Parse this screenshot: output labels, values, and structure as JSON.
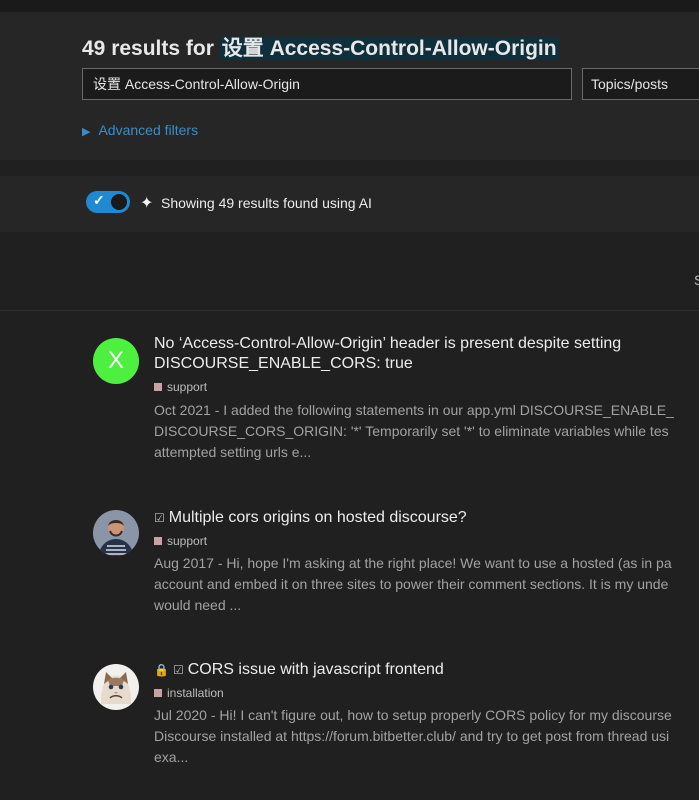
{
  "header": {
    "results_prefix": "49 results for ",
    "query_highlight": "设置 Access-Control-Allow-Origin",
    "search_value": "设置 Access-Control-Allow-Origin",
    "type_select": "Topics/posts",
    "advanced_filters": "Advanced filters"
  },
  "ai": {
    "enabled": true,
    "label": "Showing 49 results found using AI"
  },
  "sort_stub": "S",
  "results": [
    {
      "title": "No ‘Access-Control-Allow-Origin’ header is present despite setting DISCOURSE_ENABLE_CORS: true",
      "avatar_letter": "X",
      "category": "support",
      "blurb_1": "Oct 2021 - I added the following statements in our app.yml DISCOURSE_ENABLE_",
      "blurb_2": "DISCOURSE_CORS_ORIGIN: '*' Temporarily set '*' to eliminate variables while tes",
      "blurb_3": "attempted setting urls e..."
    },
    {
      "title": "Multiple cors origins on hosted discourse?",
      "category": "support",
      "blurb_1": "Aug 2017 - Hi, hope I'm asking at the right place! We want to use a hosted (as in pa",
      "blurb_2": "account and embed it on three sites to power their comment sections. It is my unde",
      "blurb_3": "would need ..."
    },
    {
      "title": "CORS issue with javascript frontend",
      "category": "installation",
      "blurb_1": "Jul 2020 - Hi! I can't figure out, how to setup properly CORS policy for my discourse",
      "blurb_2": "Discourse installed at https://forum.bitbetter.club/ and try to get post from thread usi",
      "blurb_3": "exa..."
    }
  ]
}
